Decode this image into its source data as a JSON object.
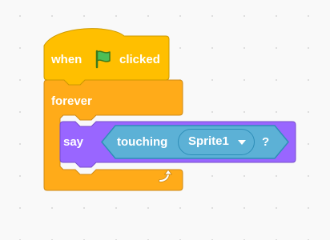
{
  "workspace": {
    "background": "#f9f9f9",
    "grid_dot_color": "#dcdcdc"
  },
  "script": {
    "hat_block": {
      "when_label": "when",
      "flag_icon": "green-flag-icon",
      "clicked_label": "clicked",
      "color": "#ffbf00",
      "border_color": "#cc9900"
    },
    "forever_block": {
      "label": "forever",
      "loop_icon": "loop-arrow-icon",
      "color": "#ffab19",
      "border_color": "#cf8b17"
    },
    "say_block": {
      "label": "say",
      "color": "#9966ff",
      "border_color": "#774dcb"
    },
    "touching_block": {
      "label": "touching",
      "question_mark": "?",
      "color": "#5cb1d6",
      "border_color": "#2e8eb8",
      "menu": {
        "selected": "Sprite1"
      }
    }
  }
}
